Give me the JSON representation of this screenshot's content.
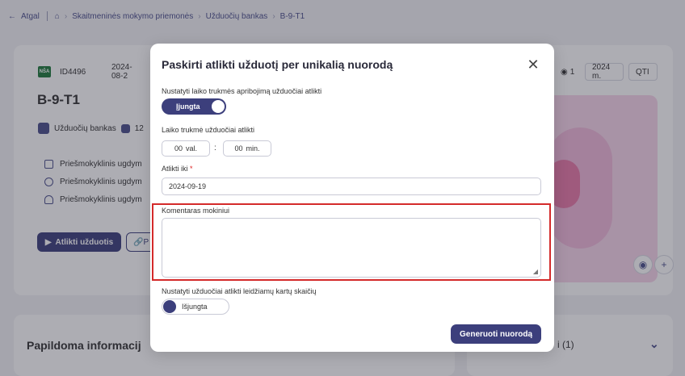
{
  "breadcrumb": {
    "back": "Atgal",
    "items": [
      "Skaitmeninės mokymo priemonės",
      "Užduočių bankas",
      "B-9-T1"
    ]
  },
  "task": {
    "badge": "NŠA",
    "id": "ID4496",
    "date": "2024-08-2",
    "views": "1",
    "year": "2024 m.",
    "format": "QTI",
    "title": "B-9-T1",
    "bank_label": "Užduočių bankas",
    "bank_count": "12",
    "edu_items": [
      "Priešmokyklinis ugdym",
      "Priešmokyklinis ugdym",
      "Priešmokyklinis ugdym"
    ],
    "do_button": "Atlikti užduotis",
    "second_button": "P"
  },
  "info": {
    "title": "Papildoma informacij",
    "right_label": "i (1)"
  },
  "modal": {
    "title": "Paskirti atlikti užduotį per unikalią nuorodą",
    "time_limit_label": "Nustatyti laiko trukmės apribojimą užduočiai atlikti",
    "time_limit_toggle": "Įjungta",
    "duration_label": "Laiko trukmė užduočiai atlikti",
    "hours_value": "00",
    "hours_unit": "val.",
    "minutes_value": "00",
    "minutes_unit": "min.",
    "due_label": "Atlikti iki",
    "due_required": "*",
    "due_value": "2024-09-19",
    "comment_label": "Komentaras mokiniui",
    "comment_value": "",
    "attempts_label": "Nustatyti užduočiai atlikti leidžiamų kartų skaičių",
    "attempts_toggle": "Išjungta",
    "generate_button": "Generuoti nuorodą"
  },
  "colors": {
    "primary": "#3c3f7c",
    "highlight": "#d42a2a"
  }
}
